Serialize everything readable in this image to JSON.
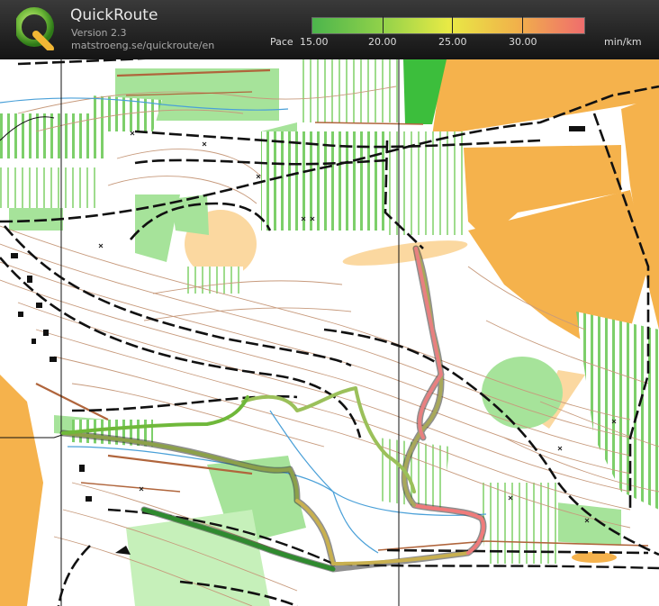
{
  "app": {
    "title": "QuickRoute",
    "version": "Version 2.3",
    "url": "matstroeng.se/quickroute/en",
    "logo_letter": "Q"
  },
  "pace_legend": {
    "label": "Pace",
    "unit": "min/km",
    "ticks": [
      "15.00",
      "20.00",
      "25.00",
      "30.00"
    ],
    "colors": [
      "#4cb54c",
      "#8fd14a",
      "#e8ea45",
      "#f1b24a",
      "#ef6d6d"
    ]
  },
  "map": {
    "colors": {
      "open_land": "#f5b24c",
      "rough_open": "#fbd8a0",
      "forest_slow": "#a6e39a",
      "forest_walk": "#3cbe3c",
      "undergrowth": "#8fd66e",
      "contour": "#b8866a",
      "track": "#111111",
      "stream": "#4aa0d8",
      "route": "#8ca04a",
      "route_fast": "#4cb54c",
      "route_slow": "#ef7b7b"
    }
  }
}
